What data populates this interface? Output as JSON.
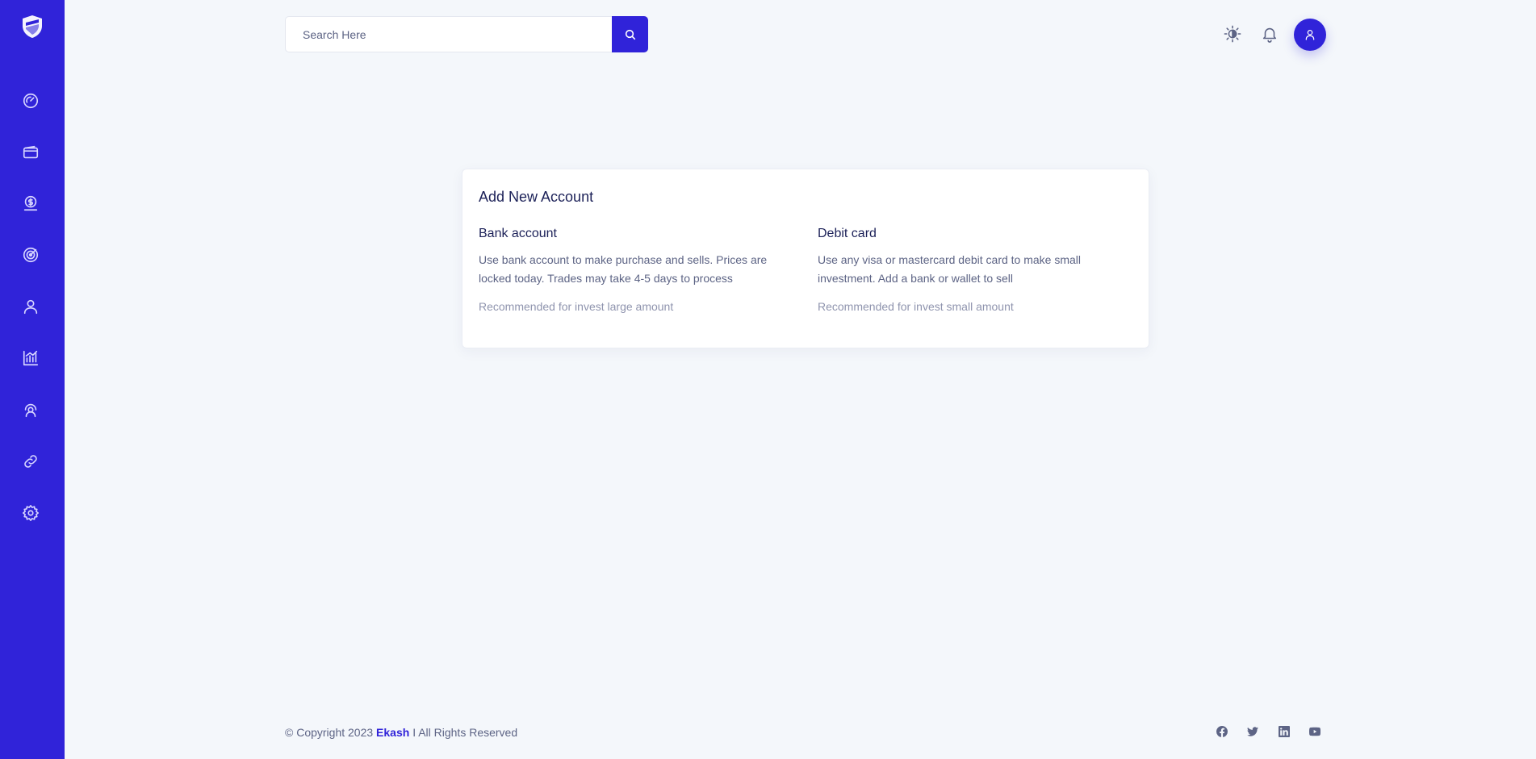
{
  "sidebar": {
    "logo_icon": "shield-logo-icon",
    "items": [
      {
        "name": "dashboard",
        "icon": "speedometer-icon"
      },
      {
        "name": "wallet",
        "icon": "wallet-icon"
      },
      {
        "name": "payments",
        "icon": "dollar-coin-icon"
      },
      {
        "name": "goals",
        "icon": "target-icon"
      },
      {
        "name": "profile",
        "icon": "user-icon"
      },
      {
        "name": "analytics",
        "icon": "bar-chart-icon"
      },
      {
        "name": "support",
        "icon": "headset-icon"
      },
      {
        "name": "links",
        "icon": "link-icon"
      },
      {
        "name": "settings",
        "icon": "gear-icon"
      }
    ]
  },
  "header": {
    "search": {
      "placeholder": "Search Here",
      "value": ""
    },
    "icons": [
      "theme-toggle-icon",
      "bell-icon",
      "user-icon"
    ]
  },
  "card": {
    "title": "Add New Account",
    "options": [
      {
        "title": "Bank account",
        "description": "Use bank account to make purchase and sells. Prices are locked today. Trades may take 4-5 days to process",
        "recommendation": "Recommended for invest large amount"
      },
      {
        "title": "Debit card",
        "description": "Use any visa or mastercard debit card to make small investment. Add a bank or wallet to sell",
        "recommendation": "Recommended for invest small amount"
      }
    ]
  },
  "footer": {
    "copyright_prefix": "© Copyright 2023",
    "brand": "Ekash",
    "copyright_suffix": "I All Rights Reserved",
    "social": [
      "facebook-icon",
      "twitter-icon",
      "linkedin-icon",
      "youtube-icon"
    ]
  },
  "colors": {
    "primary": "#3023d9",
    "background": "#f4f7fb",
    "text_dark": "#1c2158",
    "text_muted": "#5d6485"
  }
}
